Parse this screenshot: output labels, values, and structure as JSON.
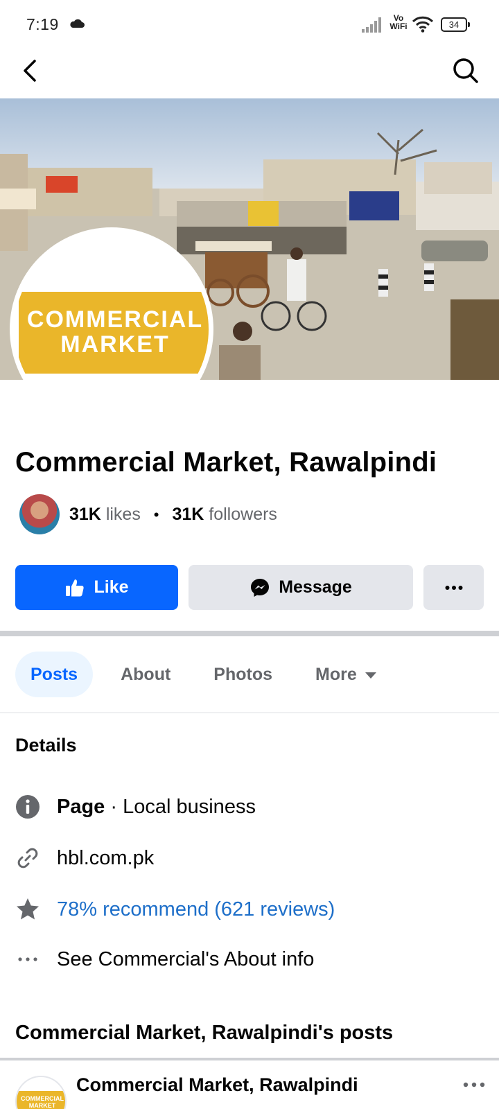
{
  "status_bar": {
    "time": "7:19",
    "vo": "Vo",
    "wifi_label": "WiFi",
    "battery": "34"
  },
  "nav": {
    "back_icon": "chevron-left-icon",
    "search_icon": "search-icon"
  },
  "profile": {
    "logo_line1": "COMMERCIAL",
    "logo_line2": "MARKET",
    "brand_color": "#eab62a"
  },
  "page": {
    "title": "Commercial Market, Rawalpindi",
    "likes_count": "31K",
    "likes_label": "likes",
    "followers_count": "31K",
    "followers_label": "followers"
  },
  "actions": {
    "like_label": "Like",
    "message_label": "Message",
    "more_icon": "more-horizontal-icon",
    "accent": "#0866ff"
  },
  "tabs": [
    {
      "label": "Posts",
      "active": true
    },
    {
      "label": "About",
      "active": false
    },
    {
      "label": "Photos",
      "active": false
    },
    {
      "label": "More",
      "active": false
    }
  ],
  "details": {
    "heading": "Details",
    "category_bold": "Page",
    "category_rest": " · Local business",
    "website": "hbl.com.pk",
    "rating": "78% recommend (621 reviews)",
    "about_link": "See Commercial's About info"
  },
  "posts": {
    "heading": "Commercial Market, Rawalpindi's posts",
    "author": "Commercial Market, Rawalpindi",
    "avatar_text": "COMMERCIAL MARKET"
  }
}
